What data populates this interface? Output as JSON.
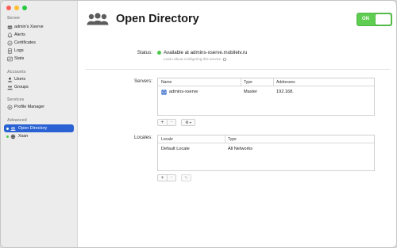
{
  "window": {
    "traffic_lights": {
      "close": "#fe5f57",
      "minimize": "#febc2e",
      "zoom": "#28c840"
    }
  },
  "sidebar": {
    "sections": [
      {
        "title": "Server",
        "items": [
          {
            "label": "admin's Xserve",
            "icon": "server-icon"
          },
          {
            "label": "Alerts",
            "icon": "bell-icon"
          },
          {
            "label": "Certificates",
            "icon": "certificate-icon"
          },
          {
            "label": "Logs",
            "icon": "logs-icon"
          },
          {
            "label": "Stats",
            "icon": "stats-icon"
          }
        ]
      },
      {
        "title": "Accounts",
        "items": [
          {
            "label": "Users",
            "icon": "user-icon"
          },
          {
            "label": "Groups",
            "icon": "group-icon"
          }
        ]
      },
      {
        "title": "Services",
        "items": [
          {
            "label": "Profile Manager",
            "icon": "profile-manager-icon"
          }
        ]
      },
      {
        "title": "Advanced",
        "items": [
          {
            "label": "Open Directory",
            "icon": "directory-icon",
            "selected": true,
            "status_color": "#ffffff"
          },
          {
            "label": "Xsan",
            "icon": "xsan-icon",
            "status_color": "#4cc94a"
          }
        ]
      }
    ]
  },
  "header": {
    "title": "Open Directory",
    "icon": "people-group-icon",
    "toggle_label": "ON",
    "toggle_color": "#5fcd52"
  },
  "status": {
    "label": "Status:",
    "text": "Available at admins-xserve.mobiletv.ru",
    "sublink": "Learn about configuring this service",
    "color": "#4cc94a"
  },
  "servers": {
    "label": "Servers:",
    "columns": [
      "Name",
      "Type",
      "Addresses"
    ],
    "rows": [
      {
        "name": "admins-xserve",
        "type": "Master",
        "address": "192.168."
      }
    ],
    "buttons": {
      "add": "+",
      "remove": "−",
      "action": "⚙"
    }
  },
  "locales": {
    "label": "Locales:",
    "columns": [
      "Locale",
      "Type"
    ],
    "rows": [
      {
        "locale": "Default Locale",
        "type": "All Networks"
      }
    ],
    "buttons": {
      "add": "+",
      "remove": "−",
      "edit": "✎"
    }
  }
}
